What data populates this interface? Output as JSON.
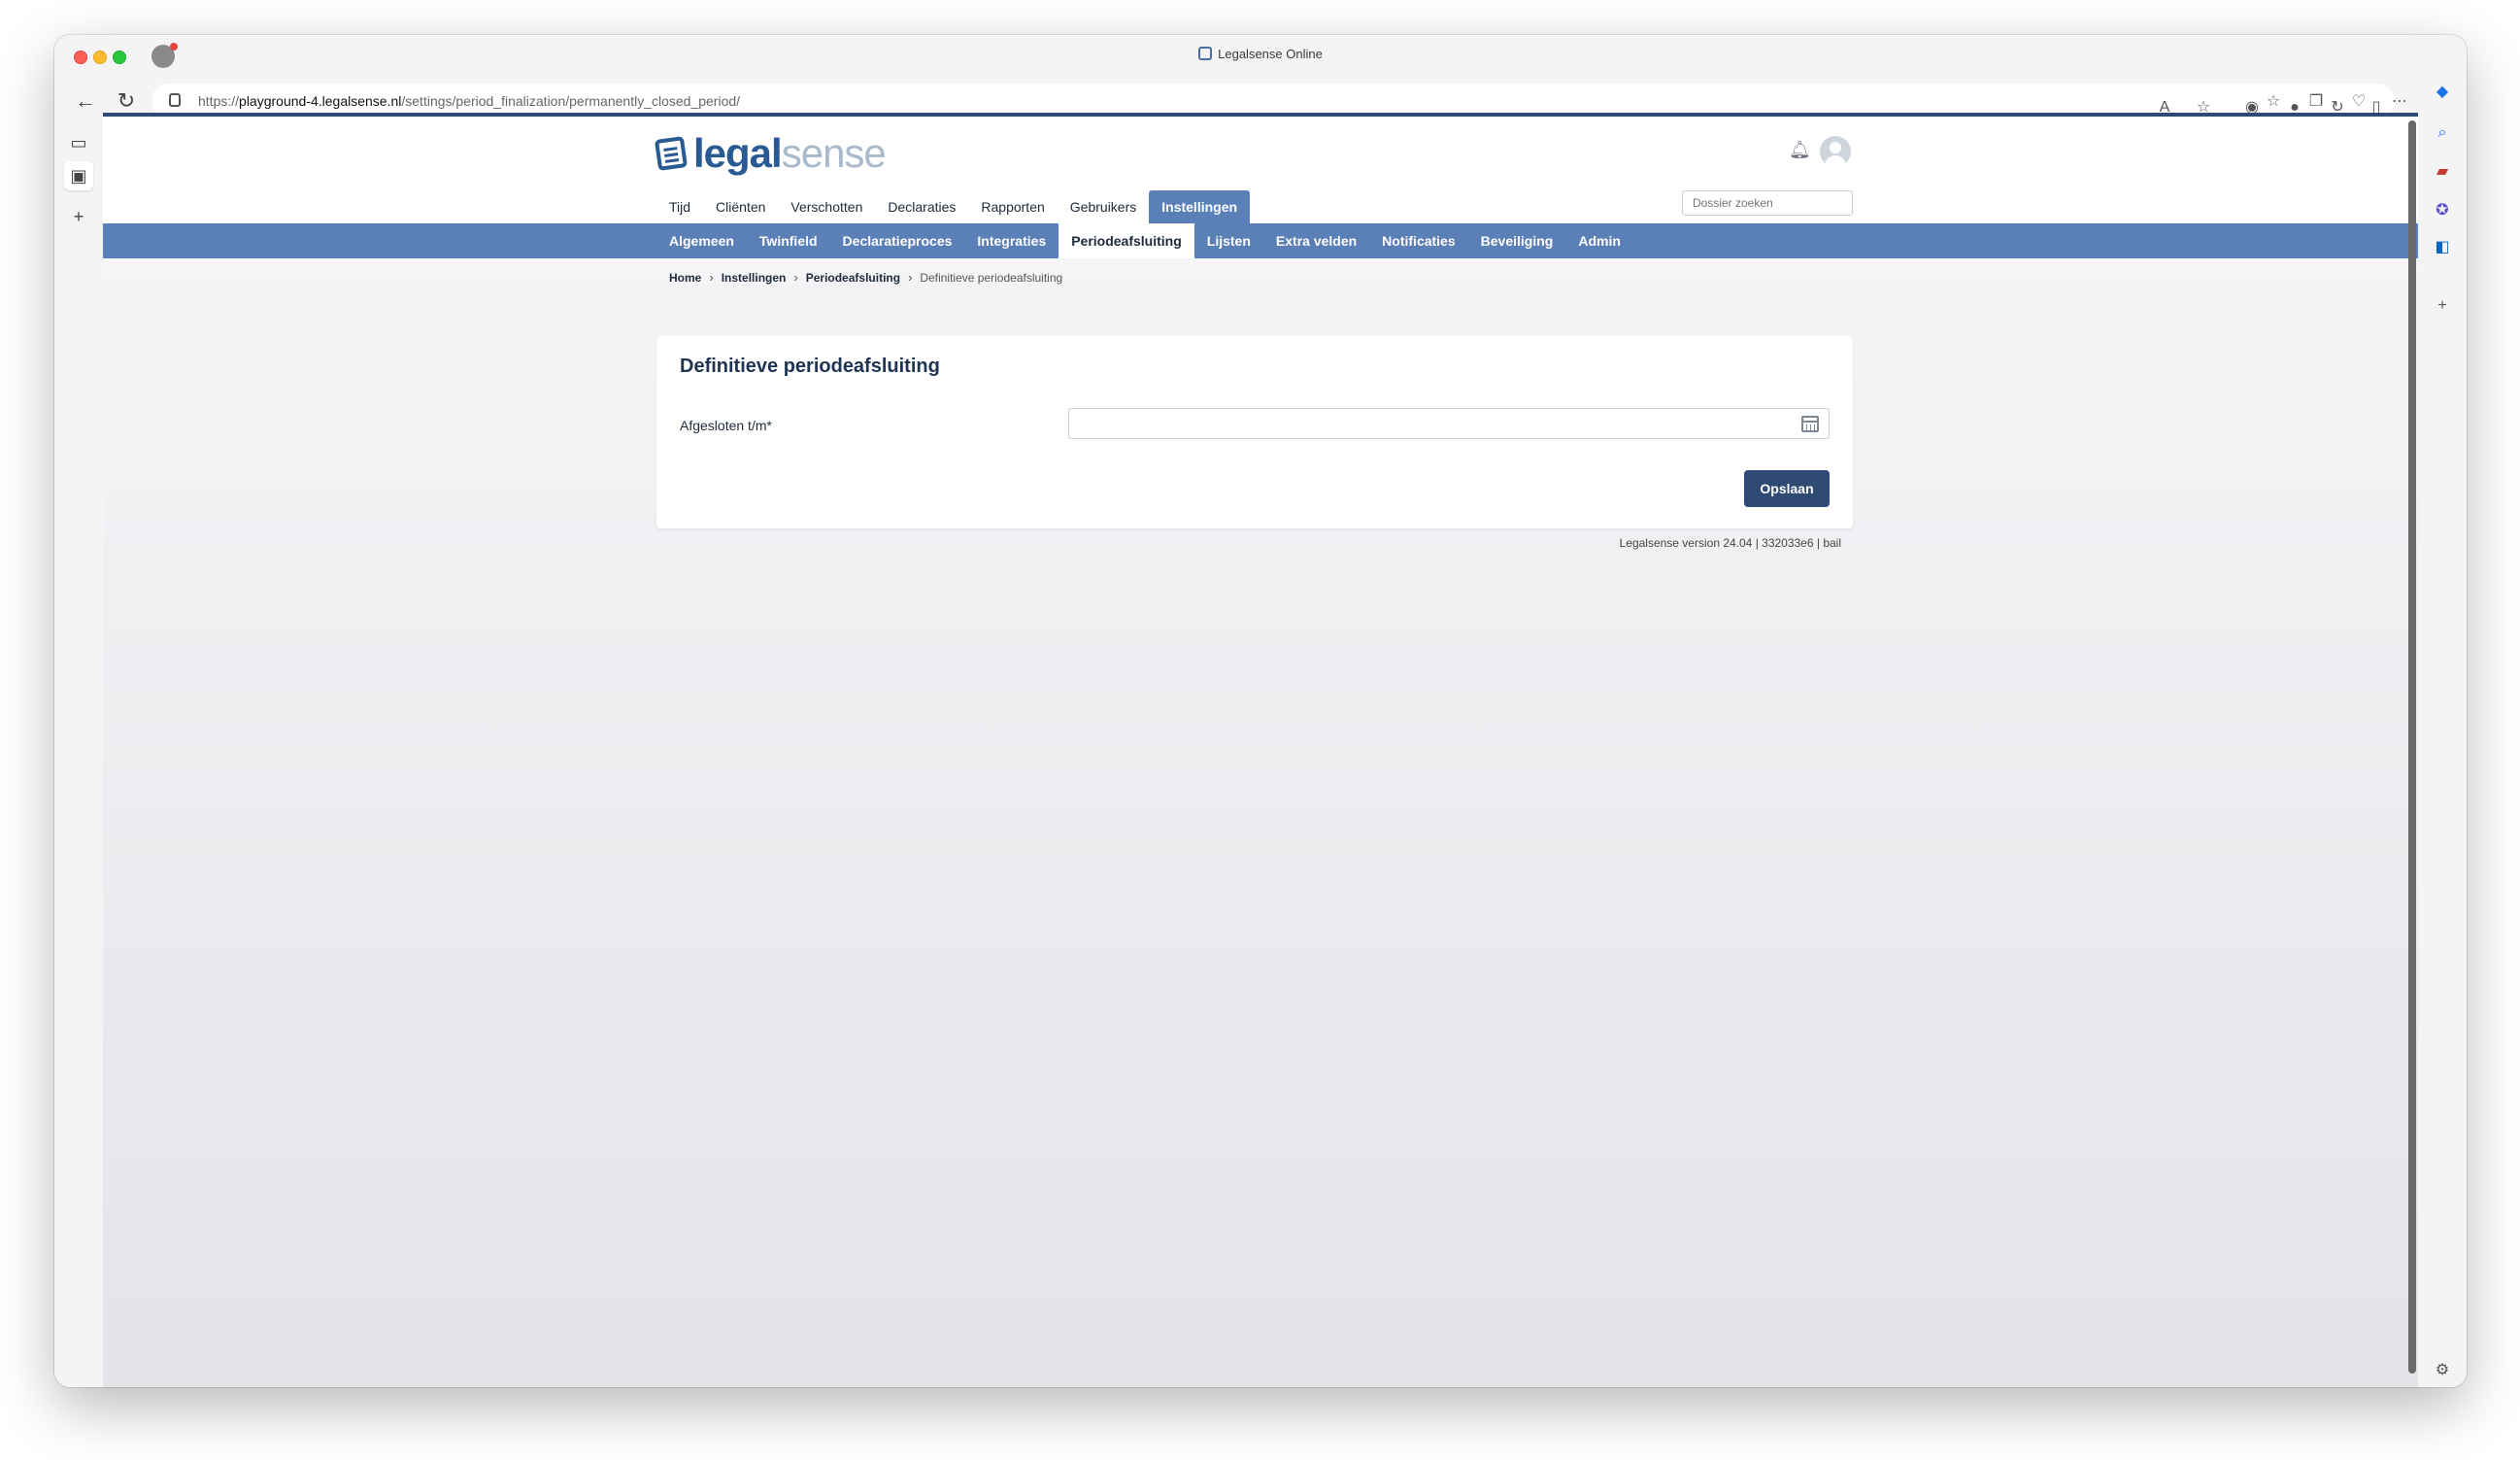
{
  "browser": {
    "window_title": "Legalsense Online",
    "url_prefix": "https://",
    "url_host": "playground-4.legalsense.nl",
    "url_path": "/settings/period_finalization/permanently_closed_period/"
  },
  "app": {
    "logo_part1": "legal",
    "logo_part2": "sense",
    "search_placeholder": "Dossier zoeken",
    "main_nav": [
      {
        "label": "Tijd"
      },
      {
        "label": "Cliënten"
      },
      {
        "label": "Verschotten"
      },
      {
        "label": "Declaraties"
      },
      {
        "label": "Rapporten"
      },
      {
        "label": "Gebruikers"
      },
      {
        "label": "Instellingen",
        "active": true
      }
    ],
    "sub_nav": [
      {
        "label": "Algemeen"
      },
      {
        "label": "Twinfield"
      },
      {
        "label": "Declaratieproces"
      },
      {
        "label": "Integraties"
      },
      {
        "label": "Periodeafsluiting",
        "active": true
      },
      {
        "label": "Lijsten"
      },
      {
        "label": "Extra velden"
      },
      {
        "label": "Notificaties"
      },
      {
        "label": "Beveiliging"
      },
      {
        "label": "Admin"
      }
    ],
    "breadcrumb": [
      {
        "label": "Home"
      },
      {
        "label": "Instellingen"
      },
      {
        "label": "Periodeafsluiting"
      },
      {
        "label": "Definitieve periodeafsluiting"
      }
    ],
    "card": {
      "title": "Definitieve periodeafsluiting",
      "field_label": "Afgesloten t/m*",
      "field_value": "",
      "save_label": "Opslaan"
    },
    "version": "Legalsense version 24.04 | 332033e6 | bail"
  },
  "colors": {
    "accent": "#5b80b8",
    "primary_button": "#2f4a73",
    "title": "#1e3452"
  }
}
